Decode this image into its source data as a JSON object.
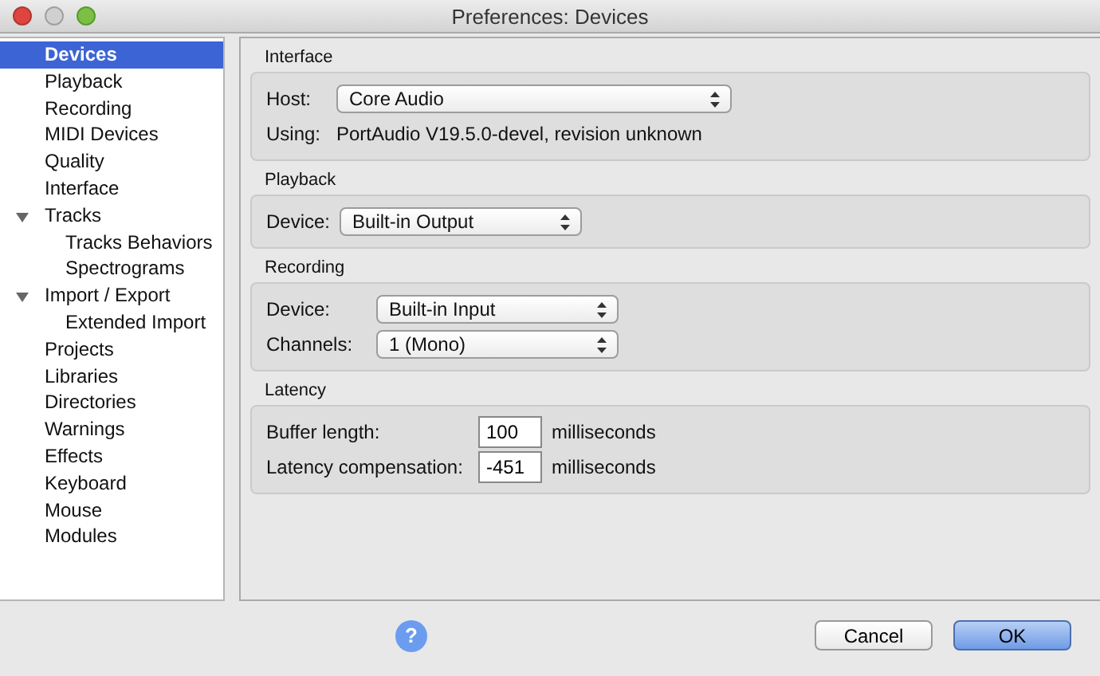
{
  "window": {
    "title": "Preferences: Devices"
  },
  "sidebar": {
    "items": [
      {
        "label": "Devices",
        "selected": true
      },
      {
        "label": "Playback",
        "selected": false
      },
      {
        "label": "Recording",
        "selected": false
      },
      {
        "label": "MIDI Devices",
        "selected": false
      },
      {
        "label": "Quality",
        "selected": false
      },
      {
        "label": "Interface",
        "selected": false
      },
      {
        "label": "Tracks",
        "selected": false,
        "expanded": true,
        "children": [
          {
            "label": "Tracks Behaviors",
            "selected": false
          },
          {
            "label": "Spectrograms",
            "selected": false
          }
        ]
      },
      {
        "label": "Import / Export",
        "selected": false,
        "expanded": true,
        "children": [
          {
            "label": "Extended Import",
            "selected": false
          }
        ]
      },
      {
        "label": "Projects",
        "selected": false
      },
      {
        "label": "Libraries",
        "selected": false
      },
      {
        "label": "Directories",
        "selected": false
      },
      {
        "label": "Warnings",
        "selected": false
      },
      {
        "label": "Effects",
        "selected": false
      },
      {
        "label": "Keyboard",
        "selected": false
      },
      {
        "label": "Mouse",
        "selected": false
      },
      {
        "label": "Modules",
        "selected": false
      }
    ]
  },
  "groups": [
    {
      "title": "Interface",
      "rows": [
        {
          "kind": "select",
          "label": "Host:",
          "value": "Core Audio"
        },
        {
          "kind": "info",
          "label": "Using:",
          "value": "PortAudio V19.5.0-devel, revision unknown"
        }
      ]
    },
    {
      "title": "Playback",
      "rows": [
        {
          "kind": "select",
          "label": "Device:",
          "value": "Built-in Output"
        }
      ]
    },
    {
      "title": "Recording",
      "rows": [
        {
          "kind": "select",
          "label": "Device:",
          "value": "Built-in Input"
        },
        {
          "kind": "select",
          "label": "Channels:",
          "value": "1 (Mono)"
        }
      ]
    },
    {
      "title": "Latency",
      "rows": [
        {
          "kind": "number",
          "label": "Buffer length:",
          "value": "100",
          "unit": "milliseconds"
        },
        {
          "kind": "number",
          "label": "Latency compensation:",
          "value": "-451",
          "unit": "milliseconds"
        }
      ]
    }
  ],
  "help_button": "?",
  "buttons": [
    {
      "label": "Cancel",
      "default": false
    },
    {
      "label": "OK",
      "default": true
    }
  ]
}
